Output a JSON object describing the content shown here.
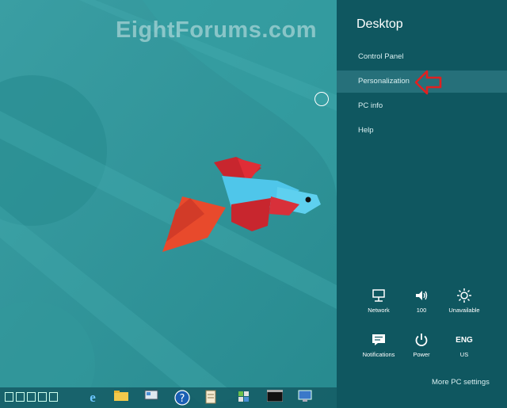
{
  "watermark": "EightForums.com",
  "charms": {
    "title": "Desktop",
    "items": [
      {
        "label": "Control Panel"
      },
      {
        "label": "Personalization"
      },
      {
        "label": "PC info"
      },
      {
        "label": "Help"
      }
    ],
    "quick_settings": [
      {
        "icon": "network-icon",
        "label": "Network"
      },
      {
        "icon": "volume-icon",
        "label": "100"
      },
      {
        "icon": "brightness-icon",
        "label": "Unavailable"
      },
      {
        "icon": "notifications-icon",
        "label": "Notifications"
      },
      {
        "icon": "power-icon",
        "label": "Power"
      },
      {
        "icon": "keyboard-language-icon",
        "glyph": "ENG",
        "label": "US"
      }
    ],
    "more_settings": "More PC settings"
  },
  "colors": {
    "charm_bg": "#0f5760",
    "highlight": "#26707a",
    "arrow": "#e02020",
    "desktop_bg": "#2d9599"
  }
}
